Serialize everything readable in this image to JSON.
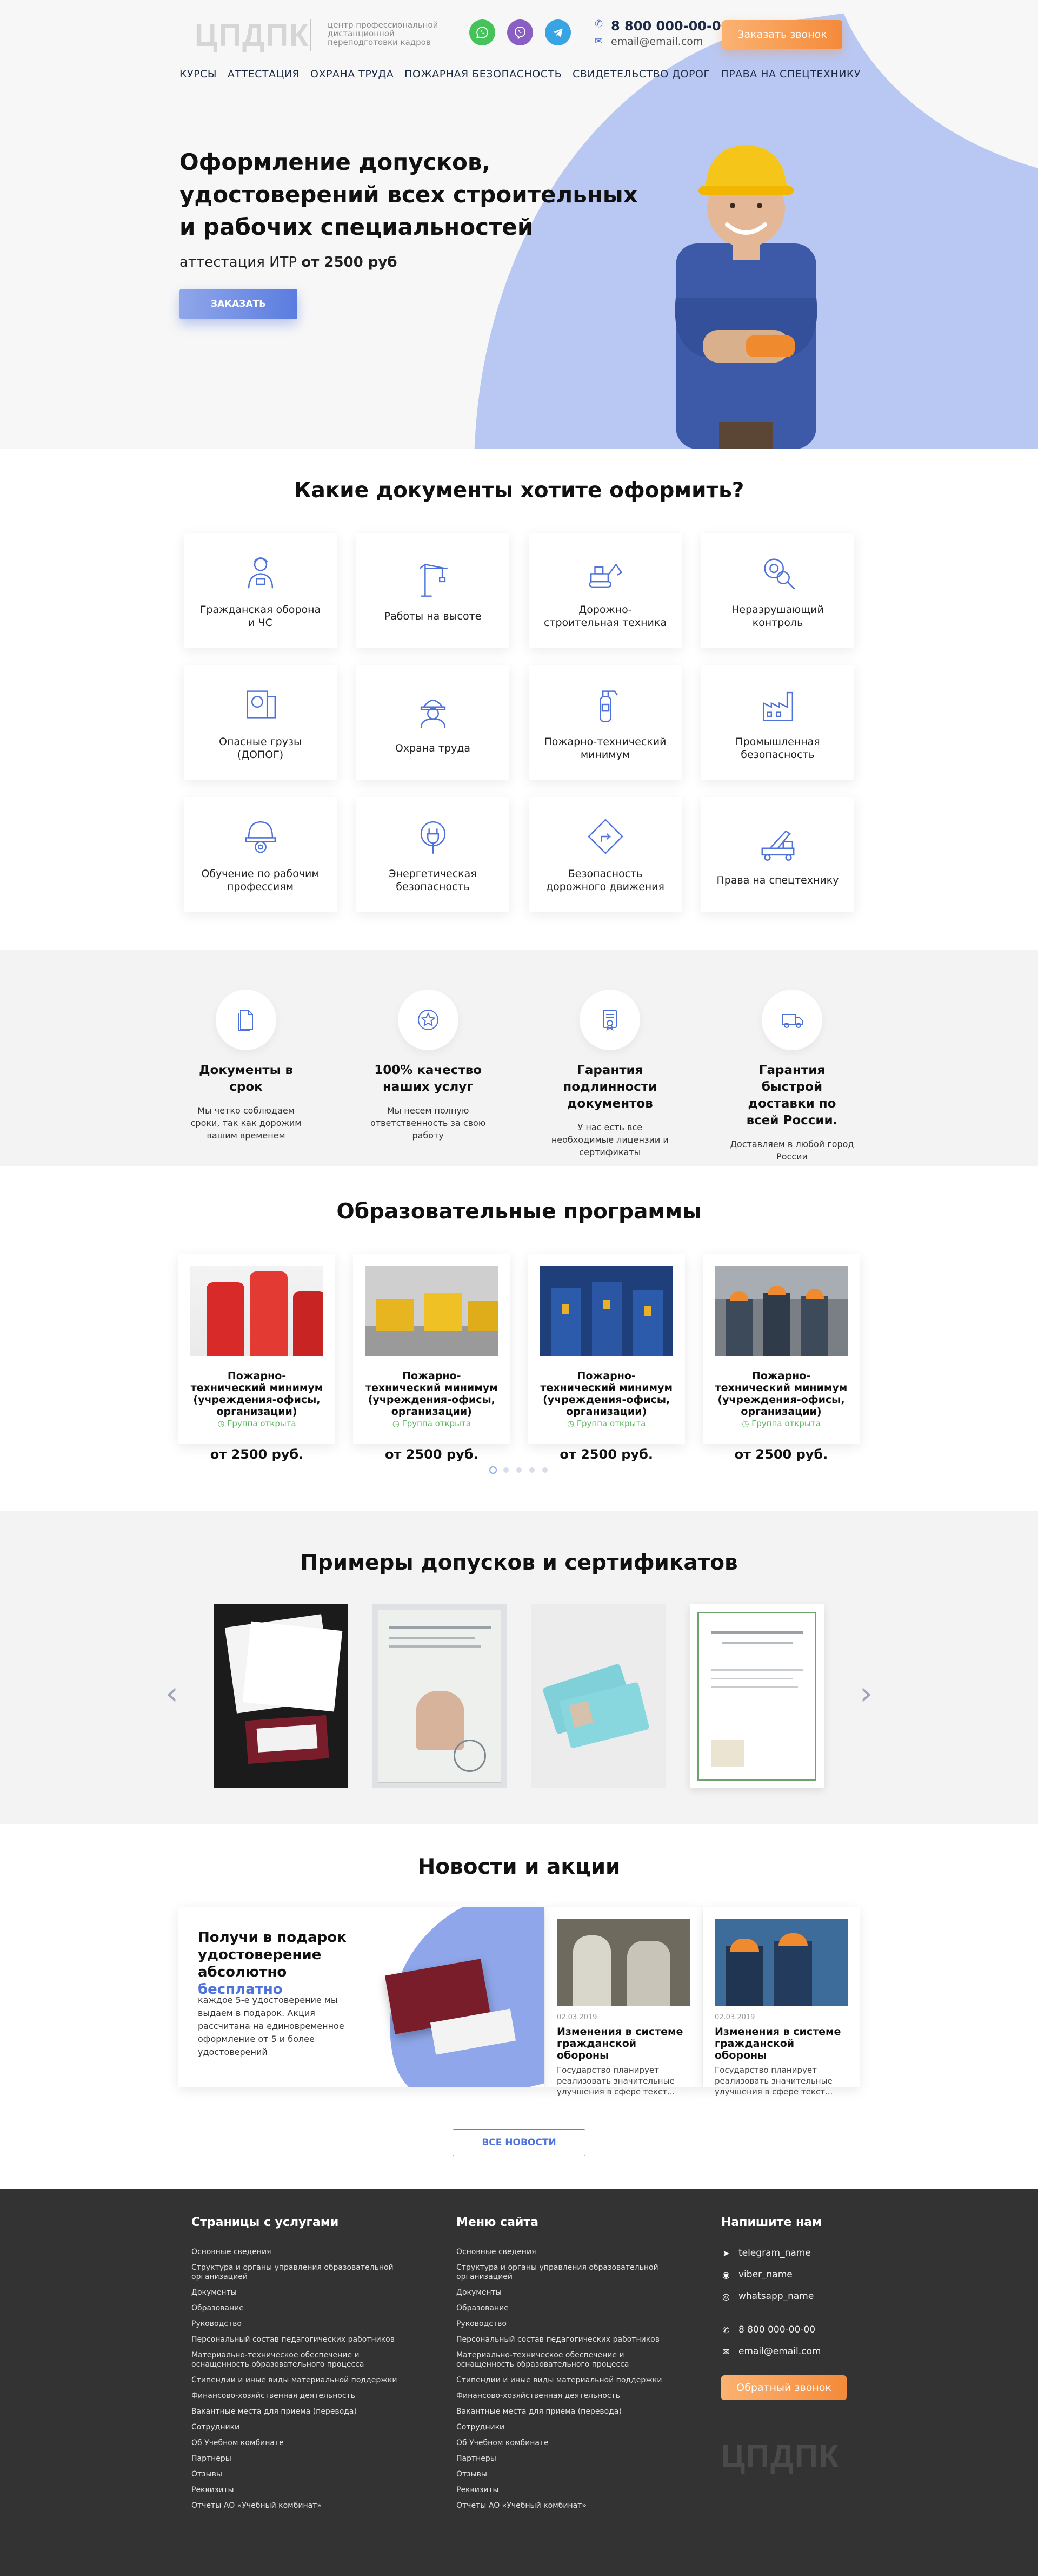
{
  "header": {
    "logo": "ЦПДПК",
    "tagline": "центр профессиональной дистанционной переподготовки кадров",
    "phone": "8 800 000-00-00",
    "email": "email@email.com",
    "callback_label": "Заказать звонок"
  },
  "nav": [
    "КУРСЫ",
    "АТТЕСТАЦИЯ",
    "ОХРАНА ТРУДА",
    "ПОЖАРНАЯ БЕЗОПАСНОСТЬ",
    "СВИДЕТЕЛЬСТВО ДОРОГ",
    "ПРАВА НА СПЕЦТЕХНИКУ"
  ],
  "hero": {
    "title": "Оформление допусков, удостоверений всех строительных и рабочих специальностей",
    "subtitle_prefix": "аттестация ИТР",
    "subtitle_price": "от 2500 руб",
    "button": "ЗАКАЗАТЬ"
  },
  "docs": {
    "title": "Какие документы хотите оформить?",
    "items": [
      {
        "label": "Гражданская оборона и ЧС",
        "icon": "civil-defense-icon"
      },
      {
        "label": "Работы на высоте",
        "icon": "crane-icon"
      },
      {
        "label": "Дорожно-строительная техника",
        "icon": "excavator-icon"
      },
      {
        "label": "Неразрушающий контроль",
        "icon": "gear-magnifier-icon"
      },
      {
        "label": "Опасные грузы (ДОПОГ)",
        "icon": "hazard-cargo-icon"
      },
      {
        "label": "Охрана труда",
        "icon": "worker-helmet-icon"
      },
      {
        "label": "Пожарно-технический минимум",
        "icon": "fire-extinguisher-icon"
      },
      {
        "label": "Промышленная безопасность",
        "icon": "factory-icon"
      },
      {
        "label": "Обучение по рабочим профессиям",
        "icon": "helmet-gear-icon"
      },
      {
        "label": "Энергетическая безопасность",
        "icon": "power-plug-icon"
      },
      {
        "label": "Безопасность дорожного движения",
        "icon": "road-sign-icon"
      },
      {
        "label": "Права на спецтехнику",
        "icon": "crane-truck-icon"
      }
    ]
  },
  "advantages": [
    {
      "title": "Документы в срок",
      "text": "Мы четко соблюдаем сроки, так как дорожим вашим временем",
      "icon": "document-icon"
    },
    {
      "title": "100% качество наших услуг",
      "text": "Мы несем полную ответственность за свою работу",
      "icon": "star-badge-icon"
    },
    {
      "title": "Гарантия подлинности документов",
      "text": "У нас есть все необходимые лицензии и сертификаты",
      "icon": "certificate-icon"
    },
    {
      "title": "Гарантия быстрой доставки по всей России.",
      "text": "Доставляем в любой город России",
      "icon": "delivery-truck-icon"
    }
  ],
  "programs": {
    "title": "Образовательные программы",
    "items": [
      {
        "name": "Пожарно-технический минимум (учреждения-офисы, организации)",
        "status": "Группа открыта",
        "price": "от 2500 руб."
      },
      {
        "name": "Пожарно-технический минимум (учреждения-офисы, организации)",
        "status": "Группа открыта",
        "price": "от 2500 руб."
      },
      {
        "name": "Пожарно-технический минимум (учреждения-офисы, организации)",
        "status": "Группа открыта",
        "price": "от 2500 руб."
      },
      {
        "name": "Пожарно-технический минимум (учреждения-офисы, организации)",
        "status": "Группа открыта",
        "price": "от 2500 руб."
      }
    ]
  },
  "examples": {
    "title": "Примеры допусков и сертификатов"
  },
  "news": {
    "title": "Новости и акции",
    "promo": {
      "title_main": "Получи в подарок удостоверение абсолютно",
      "title_highlight": "бесплатно",
      "text": "каждое 5-е удостоверение мы выдаем в подарок. Акция рассчитана на единовременное оформление от 5 и более удостоверений"
    },
    "items": [
      {
        "date": "02.03.2019",
        "title": "Изменения в системе гражданской обороны",
        "text": "Государство планирует реализовать значительные улучшения в сфере текст..."
      },
      {
        "date": "02.03.2019",
        "title": "Изменения в системе гражданской обороны",
        "text": "Государство планирует реализовать значительные улучшения в сфере текст..."
      }
    ],
    "all_button": "ВСЕ НОВОСТИ"
  },
  "footer": {
    "col1_title": "Страницы с услугами",
    "col2_title": "Меню сайта",
    "links": [
      "Основные сведения",
      "Структура и органы управления образовательной организацией",
      "Документы",
      "Образование",
      "Руководство",
      "Персональный состав педагогических работников",
      "Материально-техническое обеспечение и оснащенность образовательного процесса",
      "Стипендии и иные виды материальной поддержки",
      "Финансово-хозяйственная деятельность",
      "Вакантные места для приема (перевода)",
      "Сотрудники",
      "Об Учебном комбинате",
      "Партнеры",
      "Отзывы",
      "Реквизиты",
      "Отчеты АО «Учебный комбинат»"
    ],
    "col3_title": "Напишите нам",
    "telegram": "telegram_name",
    "viber": "viber_name",
    "whatsapp": "whatsapp_name",
    "phone": "8 800 000-00-00",
    "email": "email@email.com",
    "callback_label": "Обратный звонок",
    "logo": "ЦПДПК"
  }
}
